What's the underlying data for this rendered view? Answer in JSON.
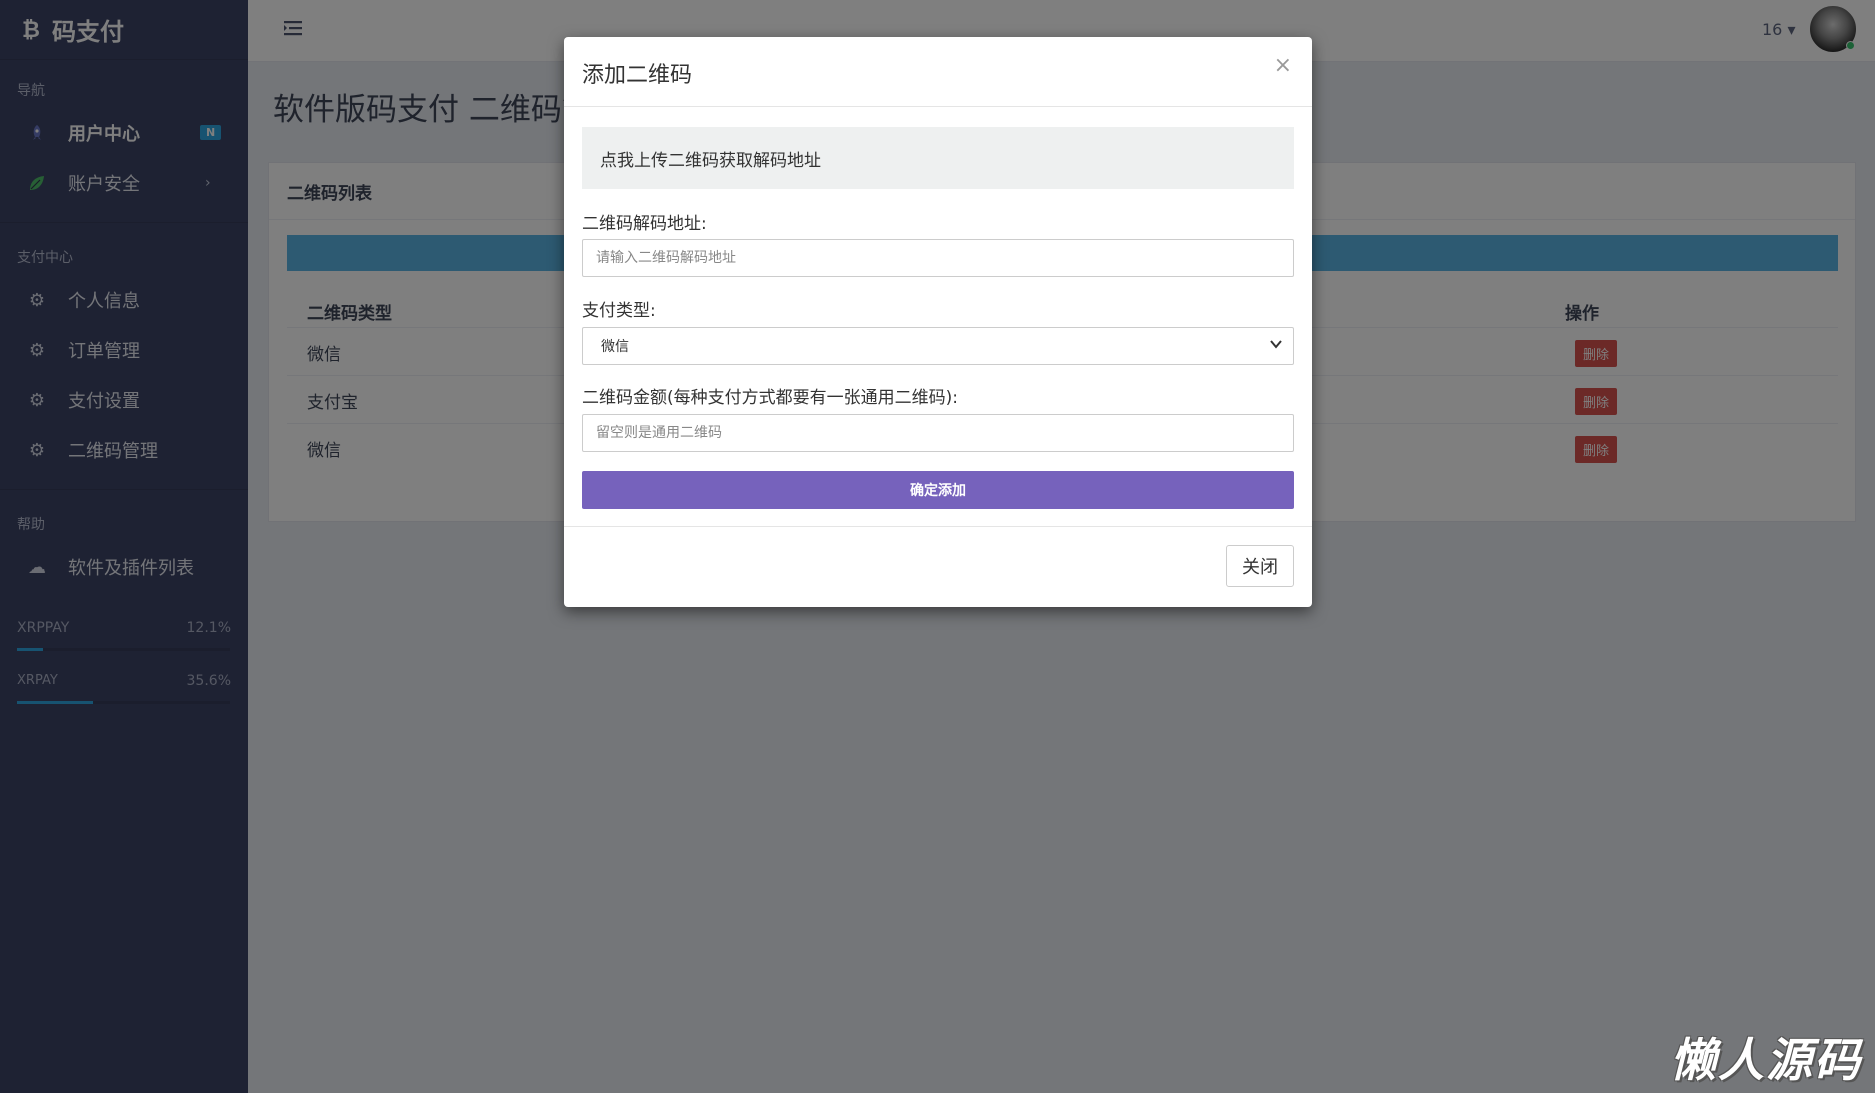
{
  "sidebar": {
    "brand": "码支付",
    "sections": {
      "nav": "导航",
      "pay_center": "支付中心",
      "help": "帮助"
    },
    "items": [
      {
        "label": "用户中心",
        "badge": "N"
      },
      {
        "label": "账户安全"
      },
      {
        "label": "个人信息"
      },
      {
        "label": "订单管理"
      },
      {
        "label": "支付设置"
      },
      {
        "label": "二维码管理"
      },
      {
        "label": "软件及插件列表"
      }
    ],
    "progress": [
      {
        "label": "XRPPAY",
        "value": "12.1%",
        "fraction": 0.121
      },
      {
        "label": "XRPAY",
        "value": "35.6%",
        "fraction": 0.356
      }
    ]
  },
  "topbar": {
    "user_num": "16 ▾"
  },
  "page": {
    "title": "软件版码支付 二维码管"
  },
  "panel": {
    "title": "二维码列表",
    "headers": {
      "type": "二维码类型",
      "action": "操作"
    },
    "rows": [
      {
        "type": "微信",
        "action": "删除"
      },
      {
        "type": "支付宝",
        "action": "删除"
      },
      {
        "type": "微信",
        "action": "删除"
      }
    ]
  },
  "modal": {
    "title": "添加二维码",
    "close_x": "×",
    "upload_label": "点我上传二维码获取解码地址",
    "decode_label": "二维码解码地址:",
    "decode_placeholder": "请输入二维码解码地址",
    "pay_type_label": "支付类型:",
    "pay_type_value": "微信",
    "amount_label": "二维码金额(每种支付方式都要有一张通用二维码):",
    "amount_placeholder": "留空则是通用二维码",
    "submit_label": "确定添加",
    "close_label": "关闭"
  },
  "watermark": "懒人源码",
  "colors": {
    "sidebar": "#3d4566",
    "accent": "#2fa6e3",
    "submit": "#7662bc",
    "danger": "#d9534f"
  }
}
